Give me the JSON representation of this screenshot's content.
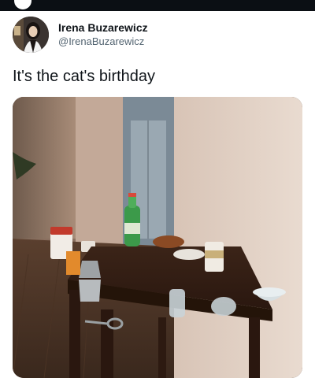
{
  "tweet": {
    "author": {
      "display_name": "Irena Buzarewicz",
      "handle": "@IrenaBuzarewicz",
      "avatar_icon": "profile-photo"
    },
    "text": "It's the cat's birthday",
    "media": {
      "description_icon": "photo-miniature-table-scene"
    }
  },
  "colors": {
    "text_primary": "#0f1419",
    "text_secondary": "#536471",
    "top_bar": "#0b0f14"
  }
}
